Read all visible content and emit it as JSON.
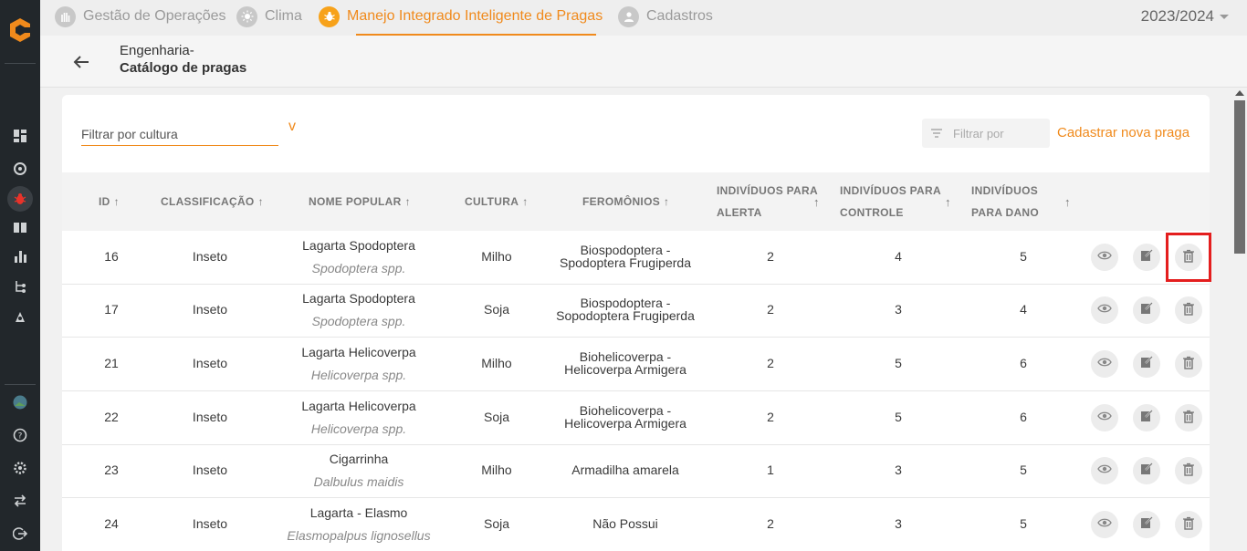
{
  "nav": {
    "tabs": [
      {
        "label": "Gestão de Operações",
        "icon": "hand-icon"
      },
      {
        "label": "Clima",
        "icon": "sun-icon"
      },
      {
        "label": "Manejo Integrado Inteligente de Pragas",
        "icon": "bug-icon",
        "active": true
      },
      {
        "label": "Cadastros",
        "icon": "user-icon"
      }
    ],
    "season": "2023/2024"
  },
  "header": {
    "crumb_parent": "Engenharia-",
    "crumb_current": "Catálogo de pragas"
  },
  "toolbar": {
    "crop_filter_placeholder": "Filtrar por cultura",
    "crop_filter_caret": "v",
    "search_placeholder": "Filtrar por",
    "new_pest_label": "Cadastrar nova praga"
  },
  "table": {
    "headers": {
      "id": "ID",
      "classification": "CLASSIFICAÇÃO",
      "popular_name": "NOME POPULAR",
      "culture": "CULTURA",
      "pheromones": "FEROMÔNIOS",
      "alert_1": "INDIVÍDUOS PARA",
      "alert_2": "ALERTA",
      "control_1": "INDIVÍDUOS PARA",
      "control_2": "CONTROLE",
      "damage_1": "INDIVÍDUOS",
      "damage_2": "PARA DANO"
    },
    "sort_arrow": "↑",
    "rows": [
      {
        "id": "16",
        "classification": "Inseto",
        "name": "Lagarta Spodoptera",
        "sci": "Spodoptera spp.",
        "culture": "Milho",
        "pher_1": "Biospodoptera -",
        "pher_2": "Spodoptera Frugiperda",
        "alert": "2",
        "control": "4",
        "damage": "5"
      },
      {
        "id": "17",
        "classification": "Inseto",
        "name": "Lagarta Spodoptera",
        "sci": "Spodoptera spp.",
        "culture": "Soja",
        "pher_1": "Biospodoptera -",
        "pher_2": "Sopodoptera Frugiperda",
        "alert": "2",
        "control": "3",
        "damage": "4"
      },
      {
        "id": "21",
        "classification": "Inseto",
        "name": "Lagarta Helicoverpa",
        "sci": "Helicoverpa spp.",
        "culture": "Milho",
        "pher_1": "Biohelicoverpa -",
        "pher_2": "Helicoverpa Armigera",
        "alert": "2",
        "control": "5",
        "damage": "6"
      },
      {
        "id": "22",
        "classification": "Inseto",
        "name": "Lagarta Helicoverpa",
        "sci": "Helicoverpa spp.",
        "culture": "Soja",
        "pher_1": "Biohelicoverpa -",
        "pher_2": "Helicoverpa Armigera",
        "alert": "2",
        "control": "5",
        "damage": "6"
      },
      {
        "id": "23",
        "classification": "Inseto",
        "name": "Cigarrinha",
        "sci": "Dalbulus maidis",
        "culture": "Milho",
        "pher_1": "Armadilha amarela",
        "pher_2": "",
        "alert": "1",
        "control": "3",
        "damage": "5"
      },
      {
        "id": "24",
        "classification": "Inseto",
        "name": "Lagarta - Elasmo",
        "sci": "Elasmopalpus lignosellus",
        "culture": "Soja",
        "pher_1": "Não Possui",
        "pher_2": "",
        "alert": "2",
        "control": "3",
        "damage": "5"
      }
    ]
  },
  "colors": {
    "accent": "#f08a1c",
    "sidebar": "#22272b",
    "highlight": "#e41e1e"
  }
}
